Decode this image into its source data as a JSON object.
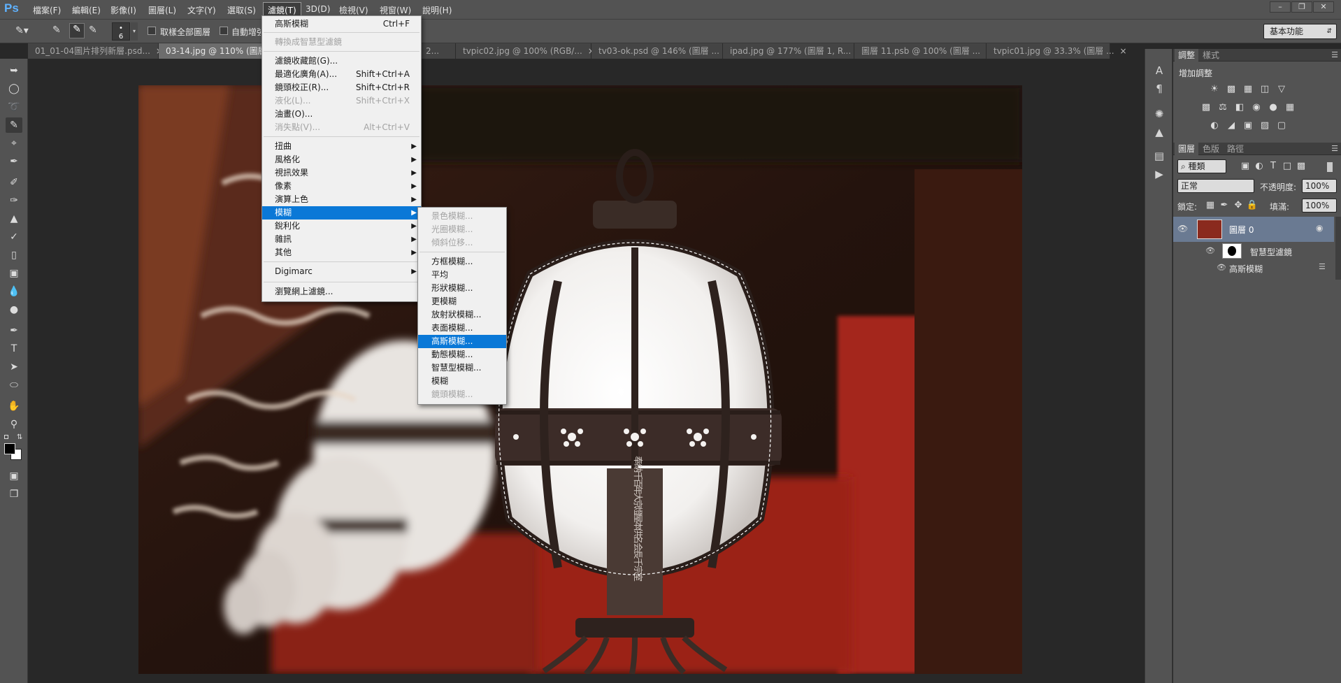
{
  "app": {
    "logo": "Ps"
  },
  "menubar": {
    "items": [
      "檔案(F)",
      "編輯(E)",
      "影像(I)",
      "圖層(L)",
      "文字(Y)",
      "選取(S)",
      "濾鏡(T)",
      "3D(D)",
      "檢視(V)",
      "視窗(W)",
      "說明(H)"
    ],
    "active": "濾鏡(T)",
    "window_buttons": [
      "minimize-icon",
      "restore-icon",
      "close-icon"
    ]
  },
  "options": {
    "brush_size": "6",
    "sample_all_layers": "取樣全部圖層",
    "auto_enhance": "自動增強",
    "workspace": "基本功能"
  },
  "tabs": [
    {
      "label": "01_01-04圖片排列新層.psd...",
      "active": false
    },
    {
      "label": "03-14.jpg @ 110% (圖層",
      "active": true
    },
    {
      "label": "2...",
      "active": false
    },
    {
      "label": "tvpic02.jpg @ 100% (RGB/...",
      "active": false
    },
    {
      "label": "tv03-ok.psd @ 146% (圖層 ...",
      "active": false
    },
    {
      "label": "ipad.jpg @ 177% (圖層 1, R...",
      "active": false
    },
    {
      "label": "圖層 11.psb @ 100% (圖層 ...",
      "active": false
    },
    {
      "label": "tvpic01.jpg @ 33.3% (圖層 ...",
      "active": false
    }
  ],
  "filter_menu": {
    "items": [
      {
        "label": "高斯模糊",
        "shortcut": "Ctrl+F",
        "disabled": false
      },
      {
        "sep": true
      },
      {
        "label": "轉換成智慧型濾鏡",
        "disabled": true
      },
      {
        "sep": true
      },
      {
        "label": "濾鏡收藏館(G)...",
        "disabled": false
      },
      {
        "label": "最適化廣角(A)...",
        "shortcut": "Shift+Ctrl+A",
        "disabled": false
      },
      {
        "label": "鏡頭校正(R)...",
        "shortcut": "Shift+Ctrl+R",
        "disabled": false
      },
      {
        "label": "液化(L)...",
        "shortcut": "Shift+Ctrl+X",
        "disabled": true
      },
      {
        "label": "油畫(O)...",
        "disabled": false
      },
      {
        "label": "消失點(V)...",
        "shortcut": "Alt+Ctrl+V",
        "disabled": true
      },
      {
        "sep": true
      },
      {
        "label": "扭曲",
        "submenu": true
      },
      {
        "label": "風格化",
        "submenu": true
      },
      {
        "label": "視訊效果",
        "submenu": true
      },
      {
        "label": "像素",
        "submenu": true
      },
      {
        "label": "演算上色",
        "submenu": true
      },
      {
        "label": "模糊",
        "submenu": true,
        "highlight": true
      },
      {
        "label": "銳利化",
        "submenu": true
      },
      {
        "label": "雜訊",
        "submenu": true
      },
      {
        "label": "其他",
        "submenu": true
      },
      {
        "sep": true
      },
      {
        "label": "Digimarc",
        "submenu": true
      },
      {
        "sep": true
      },
      {
        "label": "瀏覽網上濾鏡..."
      }
    ]
  },
  "blur_menu": {
    "items": [
      {
        "label": "景色模糊...",
        "disabled": true
      },
      {
        "label": "光圈模糊...",
        "disabled": true
      },
      {
        "label": "傾斜位移...",
        "disabled": true
      },
      {
        "sep": true
      },
      {
        "label": "方框模糊..."
      },
      {
        "label": "平均"
      },
      {
        "label": "形狀模糊..."
      },
      {
        "label": "更模糊"
      },
      {
        "label": "放射狀模糊..."
      },
      {
        "label": "表面模糊..."
      },
      {
        "label": "高斯模糊...",
        "highlight": true
      },
      {
        "label": "動態模糊..."
      },
      {
        "label": "智慧型模糊..."
      },
      {
        "label": "模糊"
      },
      {
        "label": "鏡頭模糊...",
        "disabled": true
      }
    ]
  },
  "panels": {
    "adjust_tabs": [
      "調整",
      "樣式"
    ],
    "adjust_title": "增加調整",
    "layer_tabs": [
      "圖層",
      "色版",
      "路徑"
    ],
    "kind_filter": "種類",
    "blend_mode": "正常",
    "opacity_label": "不透明度:",
    "opacity_value": "100%",
    "lock_label": "鎖定:",
    "fill_label": "填滿:",
    "fill_value": "100%",
    "layers": {
      "layer_name": "圖層 0",
      "smart_filter": "智慧型濾鏡",
      "filter_name": "高斯模糊"
    }
  },
  "canvas": {
    "lantern_text": "奉 納 千百年大京燈屋本供名 会長 千 宗室"
  }
}
